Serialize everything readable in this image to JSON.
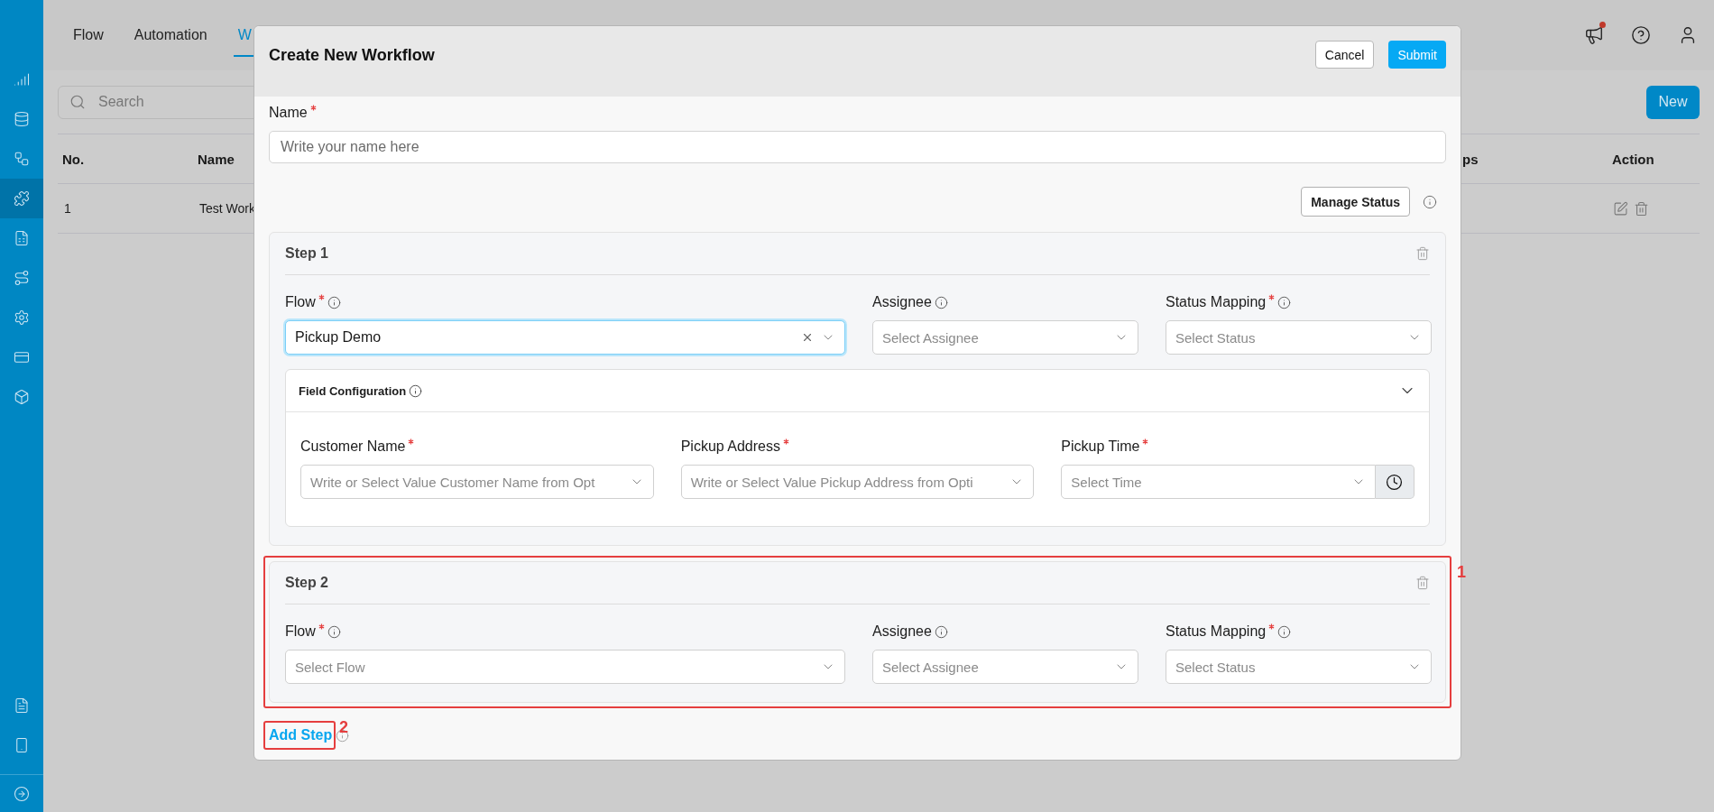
{
  "sidebar": {
    "items": [
      {
        "selected": false
      },
      {
        "selected": false
      },
      {
        "selected": false
      },
      {
        "selected": true
      },
      {
        "selected": false
      },
      {
        "selected": false
      },
      {
        "selected": false
      },
      {
        "selected": false
      },
      {
        "selected": false
      }
    ]
  },
  "tabs": [
    {
      "label": "Flow",
      "selected": false
    },
    {
      "label": "Automation",
      "selected": false
    },
    {
      "label": "W",
      "selected": true
    }
  ],
  "has_notification": true,
  "search": {
    "placeholder": "Search"
  },
  "new_button": "New",
  "table": {
    "columns": [
      "No.",
      "Name",
      "ps",
      "Action"
    ],
    "rows": [
      {
        "cells": [
          "1",
          "Test Work"
        ]
      }
    ]
  },
  "modal": {
    "title": "Create New Workflow",
    "cancel": "Cancel",
    "submit": "Submit",
    "name_field": {
      "label": "Name",
      "required": true,
      "placeholder": "Write your name here"
    },
    "manage_status": "Manage Status",
    "steps": [
      {
        "title": "Step 1",
        "fields": [
          {
            "label": "Flow",
            "required": true,
            "info": true,
            "value": "Pickup Demo",
            "focused": true,
            "clearable": true
          },
          {
            "label": "Assignee",
            "required": false,
            "info": true,
            "placeholder": "Select Assignee",
            "focused": false,
            "clearable": false
          },
          {
            "label": "Status Mapping",
            "required": true,
            "info": true,
            "placeholder": "Select Status",
            "focused": false,
            "clearable": false
          }
        ],
        "field_configuration": {
          "title": "Field Configuration",
          "expanded": true,
          "fields": [
            {
              "kind": "select",
              "label": "Customer Name",
              "required": true,
              "placeholder": "Write or Select Value Customer Name from Opt"
            },
            {
              "kind": "select",
              "label": "Pickup Address",
              "required": true,
              "placeholder": "Write or Select Value Pickup Address from Opti"
            },
            {
              "kind": "time",
              "label": "Pickup Time",
              "required": true,
              "placeholder": "Select Time"
            }
          ]
        }
      },
      {
        "title": "Step 2",
        "fields": [
          {
            "label": "Flow",
            "required": true,
            "info": true,
            "placeholder": "Select Flow",
            "focused": false,
            "clearable": false
          },
          {
            "label": "Assignee",
            "required": false,
            "info": true,
            "placeholder": "Select Assignee",
            "focused": false,
            "clearable": false
          },
          {
            "label": "Status Mapping",
            "required": true,
            "info": true,
            "placeholder": "Select Status",
            "focused": false,
            "clearable": false
          }
        ]
      }
    ],
    "add_step": "Add Step"
  },
  "annotations": [
    {
      "label": "1"
    },
    {
      "label": "2"
    }
  ]
}
